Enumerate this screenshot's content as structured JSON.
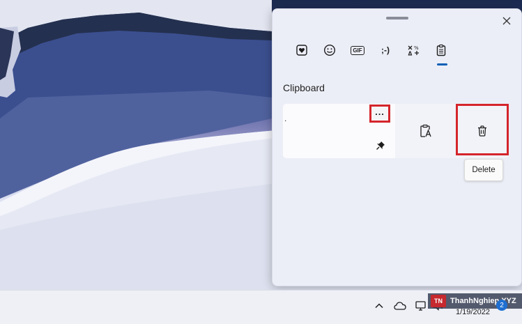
{
  "panel": {
    "tabs": [
      {
        "name": "emoji-tab",
        "icon": "heart-emoji-icon"
      },
      {
        "name": "kaomoji-smiley-tab",
        "icon": "smiley-icon"
      },
      {
        "name": "gif-tab",
        "label": "GIF"
      },
      {
        "name": "kaomoji-tab",
        "label": ";-)"
      },
      {
        "name": "symbols-tab",
        "icon": "symbols-icon"
      },
      {
        "name": "clipboard-tab",
        "icon": "clipboard-icon",
        "active": true
      }
    ],
    "section_title": "Clipboard",
    "clip_item": {
      "text": ".",
      "more_label": "...",
      "pin_icon": "pin-icon"
    },
    "paste_icon": "paste-as-text-icon",
    "delete_icon": "trash-icon",
    "tooltip": "Delete",
    "highlight_color": "#d4252b",
    "accent_color": "#0a5fb4"
  },
  "taskbar": {
    "tray_icons": [
      "chevron-up-icon",
      "cloud-icon",
      "display-icon",
      "speaker-icon"
    ],
    "time": "",
    "date": "1/19/2022",
    "notification_count": "2",
    "watermark_logo": "TN",
    "watermark_text": "ThanhNghiep.XYZ"
  }
}
